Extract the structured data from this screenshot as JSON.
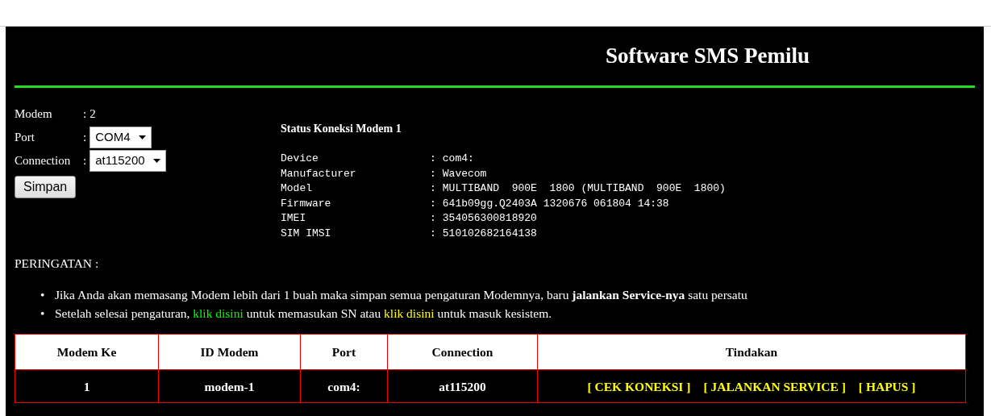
{
  "header": {
    "title": "Software SMS Pemilu"
  },
  "settings": {
    "fields": [
      {
        "label": "Modem",
        "colon": ":",
        "kind": "text",
        "value": "2"
      },
      {
        "label": "Port",
        "colon": ":",
        "kind": "select",
        "value": "COM4"
      },
      {
        "label": "Connection",
        "colon": ":",
        "kind": "select",
        "value": "at115200"
      }
    ],
    "button": "Simpan"
  },
  "status": {
    "title": "Status Koneksi Modem 1",
    "rows": [
      {
        "label": "Device",
        "colon": ":",
        "value": "com4:"
      },
      {
        "label": "Manufacturer",
        "colon": ":",
        "value": "Wavecom"
      },
      {
        "label": "Model",
        "colon": ":",
        "value": "MULTIBAND  900E  1800 (MULTIBAND  900E  1800)"
      },
      {
        "label": "Firmware",
        "colon": ":",
        "value": "641b09gg.Q2403A 1320676 061804 14:38"
      },
      {
        "label": "IMEI",
        "colon": ":",
        "value": "354056300818920"
      },
      {
        "label": "SIM IMSI",
        "colon": ":",
        "value": "510102682164138"
      }
    ]
  },
  "warning": {
    "title": "PERINGATAN :",
    "items": [
      {
        "bullet": "•",
        "parts": [
          {
            "kind": "text",
            "text": "Jika Anda akan memasang Modem lebih dari 1 buah maka simpan semua pengaturan Modemnya, baru **jalankan Service-nya** satu persatu"
          }
        ]
      },
      {
        "bullet": "•",
        "parts": [
          {
            "kind": "text",
            "text": "Setelah selesai pengaturan, "
          },
          {
            "kind": "link",
            "text": "klik disini",
            "color": "#00ff00"
          },
          {
            "kind": "text",
            "text": " untuk memasukan SN atau "
          },
          {
            "kind": "link",
            "text": "klik disini",
            "color": "#ffff00"
          },
          {
            "kind": "text",
            "text": " untuk masuk kesistem."
          }
        ]
      }
    ]
  },
  "table": {
    "columns": [
      "Modem Ke",
      "ID Modem",
      "Port",
      "Connection",
      "Tindakan"
    ],
    "rows": [
      {
        "cells": [
          "1",
          "modem-1",
          "com4:",
          "at115200"
        ],
        "actions": [
          "[ CEK KONEKSI ]",
          "[ JALANKAN SERVICE ]",
          "[ HAPUS ]"
        ]
      }
    ]
  }
}
